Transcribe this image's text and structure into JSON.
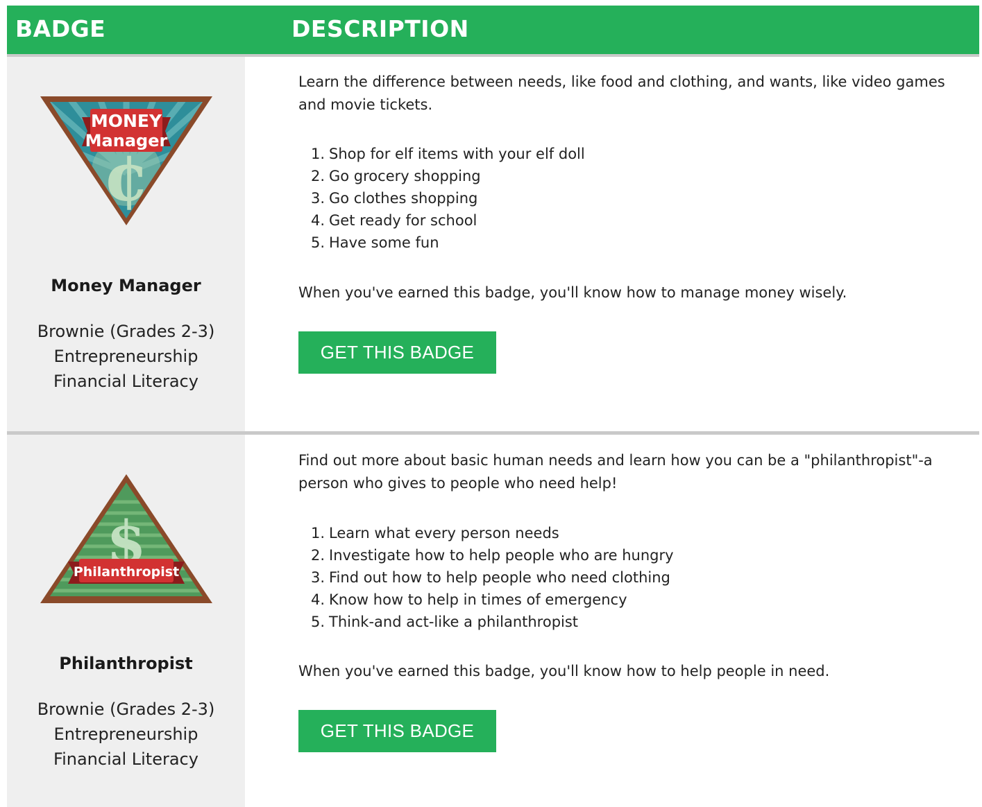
{
  "header": {
    "badge_col": "BADGE",
    "description_col": "DESCRIPTION",
    "background": "#25b05a"
  },
  "badges": [
    {
      "emblem_text_1": "MONEY",
      "emblem_text_2": "Manager",
      "emblem_symbol": "¢",
      "name": "Money Manager",
      "level": "Brownie (Grades 2-3)",
      "category_1": "Entrepreneurship",
      "category_2": "Financial Literacy",
      "intro": "Learn the difference between needs, like food and clothing, and wants, like video games and movie tickets.",
      "steps": [
        {
          "num": "1.",
          "text": "Shop for elf items with your elf doll"
        },
        {
          "num": "2.",
          "text": "Go grocery shopping"
        },
        {
          "num": "3.",
          "text": "Go clothes shopping"
        },
        {
          "num": "4.",
          "text": "Get ready for school"
        },
        {
          "num": "5.",
          "text": "Have some fun"
        }
      ],
      "summary": "When you've earned this badge, you'll know how to manage money wisely.",
      "button": "GET THIS BADGE"
    },
    {
      "emblem_text_1": "Philanthropist",
      "emblem_symbol": "$",
      "name": "Philanthropist",
      "level": "Brownie (Grades 2-3)",
      "category_1": "Entrepreneurship",
      "category_2": "Financial Literacy",
      "intro": "Find out more about basic human needs and learn how you can be a \"philanthropist\"-a person who gives to people who need help!",
      "steps": [
        {
          "num": "1.",
          "text": "Learn what every person needs"
        },
        {
          "num": "2.",
          "text": "Investigate how to help people who are hungry"
        },
        {
          "num": "3.",
          "text": "Find out how to help people who need clothing"
        },
        {
          "num": "4.",
          "text": "Know how to help in times of emergency"
        },
        {
          "num": "5.",
          "text": "Think-and act-like a philanthropist"
        }
      ],
      "summary": "When you've earned this badge, you'll know how to help people in need.",
      "button": "GET THIS BADGE"
    }
  ]
}
